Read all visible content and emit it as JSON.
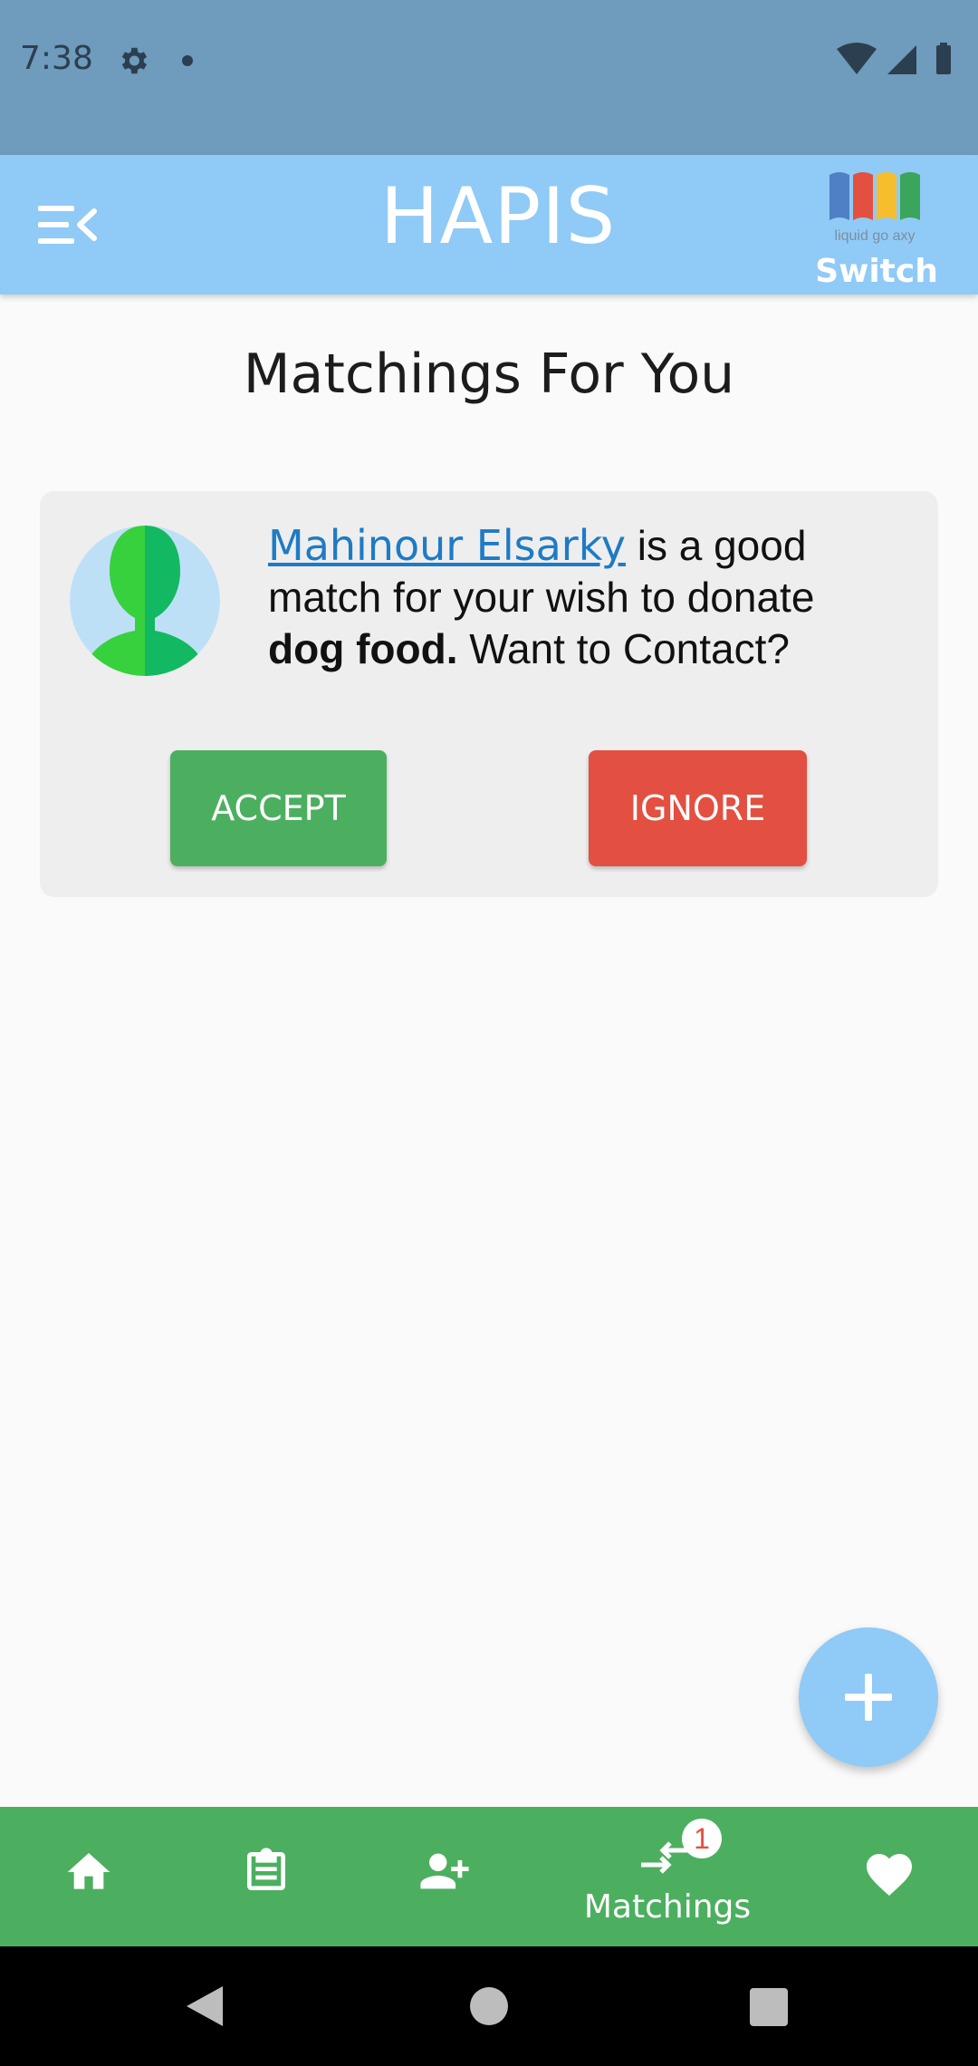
{
  "status_bar": {
    "time": "7:38",
    "icons": [
      "gear-icon",
      "notification-dot-icon",
      "wifi-icon",
      "signal-icon",
      "battery-icon"
    ]
  },
  "app_bar": {
    "title": "HAPIS",
    "switch_label": "Switch",
    "logo_caption": "liquid go axy",
    "icons": [
      "menu-collapse-icon"
    ]
  },
  "main": {
    "title": "Matchings For You",
    "match": {
      "name": "Mahinour Elsarky",
      "text_part1": " is a good match for your wish to donate ",
      "item": "dog food.",
      "text_part2": " Want to Contact?",
      "accept_label": "ACCEPT",
      "ignore_label": "IGNORE"
    }
  },
  "bottom_nav": {
    "items": [
      "home-icon",
      "clipboard-icon",
      "add-user-icon",
      "matchings-icon",
      "heart-icon"
    ],
    "matchings_label": "Matchings",
    "matchings_badge": "1"
  },
  "colors": {
    "status_bar": "#6f9bbc",
    "app_bar": "#90caf6",
    "accept": "#4caf5f",
    "ignore": "#e34f40",
    "nav": "#4caf5f",
    "link": "#1e7bc4"
  }
}
